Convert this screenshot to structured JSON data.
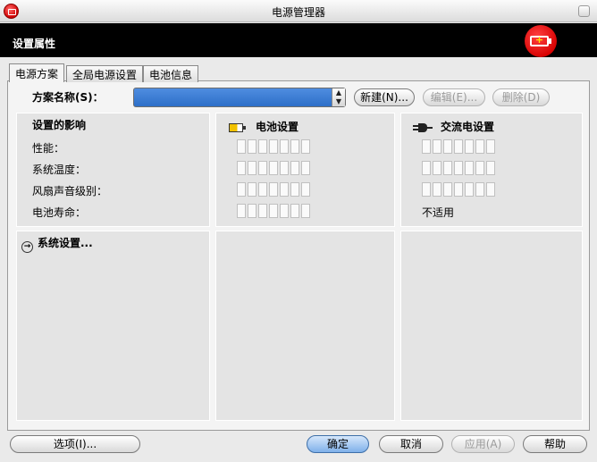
{
  "window": {
    "title": "电源管理器"
  },
  "header": {
    "title": "设置属性",
    "badge_icon": "battery-plus-icon"
  },
  "tabs": [
    {
      "label": "电源方案",
      "active": true
    },
    {
      "label": "全局电源设置",
      "active": false
    },
    {
      "label": "电池信息",
      "active": false
    }
  ],
  "plan": {
    "label": "方案名称(S)：",
    "selected_value": "",
    "buttons": {
      "new": "新建(N)...",
      "edit": "编辑(E)...",
      "delete": "删除(D)"
    }
  },
  "settings": {
    "title": "设置的影响",
    "rows": [
      "性能：",
      "系统温度：",
      "风扇声音级别：",
      "电池寿命："
    ],
    "battery_title": "电池设置",
    "ac_title": "交流电设置",
    "battery_levels": [
      0,
      0,
      0,
      0
    ],
    "ac_levels": [
      0,
      0,
      0,
      null
    ],
    "ac_battery_life_text": "不适用",
    "segments": 7
  },
  "system_link": "系统设置...",
  "footer": {
    "options": "选项(I)...",
    "ok": "确定",
    "cancel": "取消",
    "apply": "应用(A)",
    "help": "帮助"
  },
  "colors": {
    "accent": "#d60000",
    "header_bg": "#000000",
    "selection": "#3a7bd5"
  }
}
